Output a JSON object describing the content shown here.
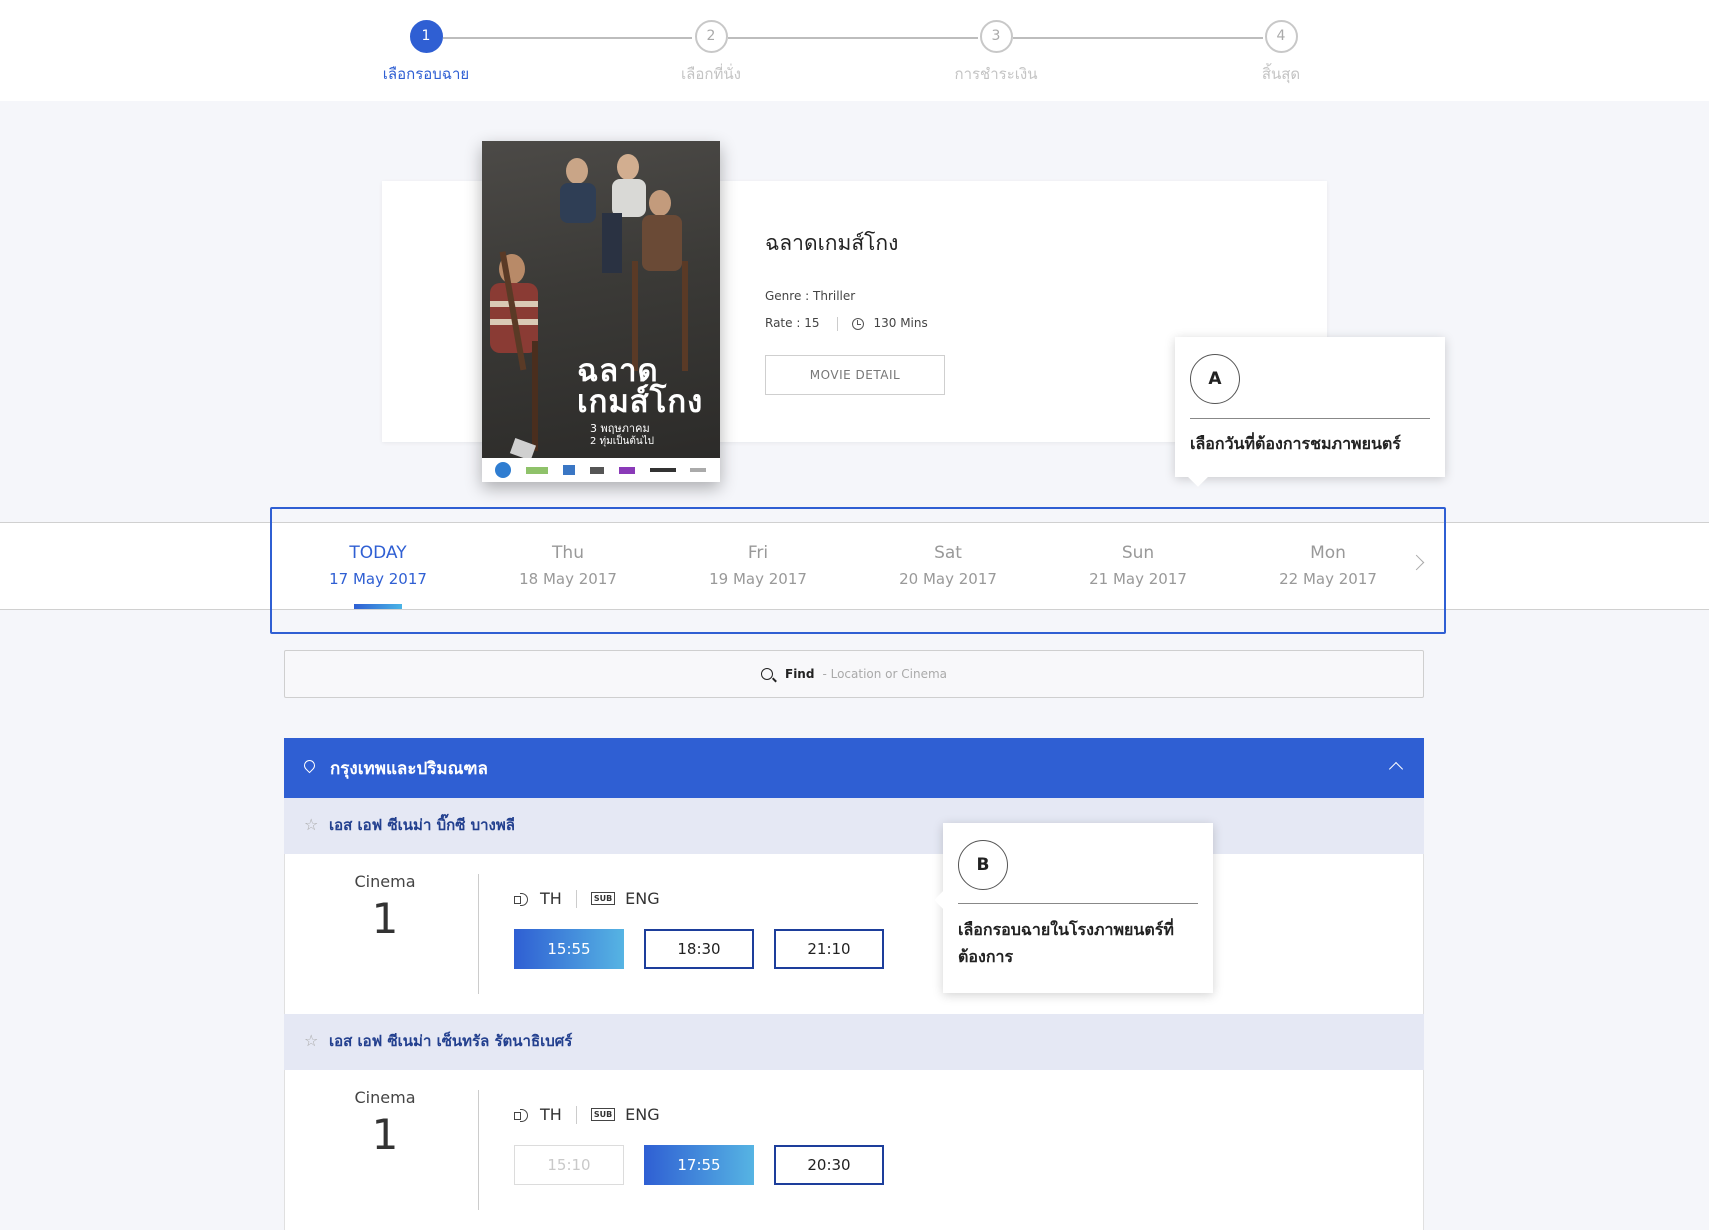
{
  "stepper": {
    "steps": [
      {
        "number": "1",
        "label": "เลือกรอบฉาย"
      },
      {
        "number": "2",
        "label": "เลือกที่นั่ง"
      },
      {
        "number": "3",
        "label": "การชำระเงิน"
      },
      {
        "number": "4",
        "label": "สิ้นสุด"
      }
    ],
    "active_step": 1
  },
  "movie": {
    "title": "ฉลาดเกมส์โกง",
    "genre": "Genre : Thriller",
    "rate": "Rate : 15",
    "duration": "130 Mins",
    "detail_button": "MOVIE DETAIL",
    "poster": {
      "title_line1": "ฉลาด",
      "title_line2": "เกมส์โกง",
      "date_line1": "3 พฤษภาคม",
      "date_line2": "2 ทุ่มเป็นต้นไป"
    }
  },
  "tooltips": {
    "a": {
      "badge": "A",
      "text": "เลือกวันที่ต้องการชมภาพยนตร์"
    },
    "b": {
      "badge": "B",
      "text_line1": "เลือกรอบฉายในโรงภาพยนตร์ที่",
      "text_line2": "ต้องการ"
    }
  },
  "dates": [
    {
      "day": "TODAY",
      "date": "17 May 2017",
      "active": true
    },
    {
      "day": "Thu",
      "date": "18 May 2017"
    },
    {
      "day": "Fri",
      "date": "19 May 2017"
    },
    {
      "day": "Sat",
      "date": "20 May 2017"
    },
    {
      "day": "Sun",
      "date": "21 May 2017"
    },
    {
      "day": "Mon",
      "date": "22 May 2017"
    }
  ],
  "find": {
    "label": "Find",
    "placeholder": "- Location or Cinema"
  },
  "region": {
    "name": "กรุงเทพและปริมณฑล"
  },
  "cinemas": [
    {
      "name": "เอส เอฟ ซีเนม่า บิ๊กซี บางพลี",
      "hall_label": "Cinema",
      "hall_number": "1",
      "audio": "TH",
      "sub_icon": "SUB",
      "subtitle": "ENG",
      "times": [
        {
          "time": "15:55",
          "state": "selected"
        },
        {
          "time": "18:30",
          "state": "available"
        },
        {
          "time": "21:10",
          "state": "available"
        }
      ]
    },
    {
      "name": "เอส เอฟ ซีเนม่า เซ็นทรัล รัตนาธิเบศร์",
      "hall_label": "Cinema",
      "hall_number": "1",
      "audio": "TH",
      "sub_icon": "SUB",
      "subtitle": "ENG",
      "times": [
        {
          "time": "15:10",
          "state": "disabled"
        },
        {
          "time": "17:55",
          "state": "selected"
        },
        {
          "time": "20:30",
          "state": "available"
        }
      ]
    }
  ],
  "colors": {
    "accent": "#2f5fd3",
    "cinema_header": "#e5e8f4",
    "cinema_name": "#23408f"
  }
}
